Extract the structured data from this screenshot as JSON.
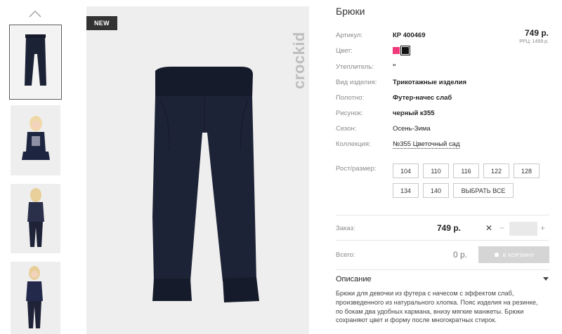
{
  "product": {
    "title": "Брюки",
    "badge": "NEW",
    "brand": "crockid",
    "price": "749 р.",
    "rrc": "РРЦ: 1499 р."
  },
  "attributes": [
    {
      "label": "Артикул:",
      "value": "КР 400469"
    },
    {
      "label": "Цвет:",
      "value": ""
    },
    {
      "label": "Утеплитель:",
      "value": "\""
    },
    {
      "label": "Вид изделия:",
      "value": "Трикотажные изделия"
    },
    {
      "label": "Полотно:",
      "value": "Футер-начес слаб"
    },
    {
      "label": "Рисунок:",
      "value": "черный к355"
    },
    {
      "label": "Сезон:",
      "value": "Осень-Зима"
    },
    {
      "label": "Коллекция:",
      "value": "№355 Цветочный сад"
    }
  ],
  "colors": [
    "#f0397a",
    "#111111"
  ],
  "sizes_label": "Рост/размер:",
  "sizes": [
    "104",
    "110",
    "116",
    "122",
    "128",
    "134",
    "140"
  ],
  "select_all": "ВЫБРАТЬ ВСЕ",
  "order": {
    "label": "Заказ:",
    "price": "749 р.",
    "remove": "✕",
    "minus": "−",
    "plus": "+",
    "quantity": ""
  },
  "total": {
    "label": "Всего:",
    "value": "0 р.",
    "cart_button": "В КОРЗИНУ"
  },
  "description": {
    "title": "Описание",
    "text": "Брюки для девочки из футера с начесом с эффектом слаб, произведенного из натурального хлопка. Пояс изделия на резинке, по бокам два удобных кармана, внизу мягкие манжеты. Брюки сохраняют цвет и форму после многократных стирок."
  },
  "icons": {
    "thumbs_up": "chevron-up-icon",
    "cart": "cart-icon",
    "desc": "chevron-down-icon"
  }
}
